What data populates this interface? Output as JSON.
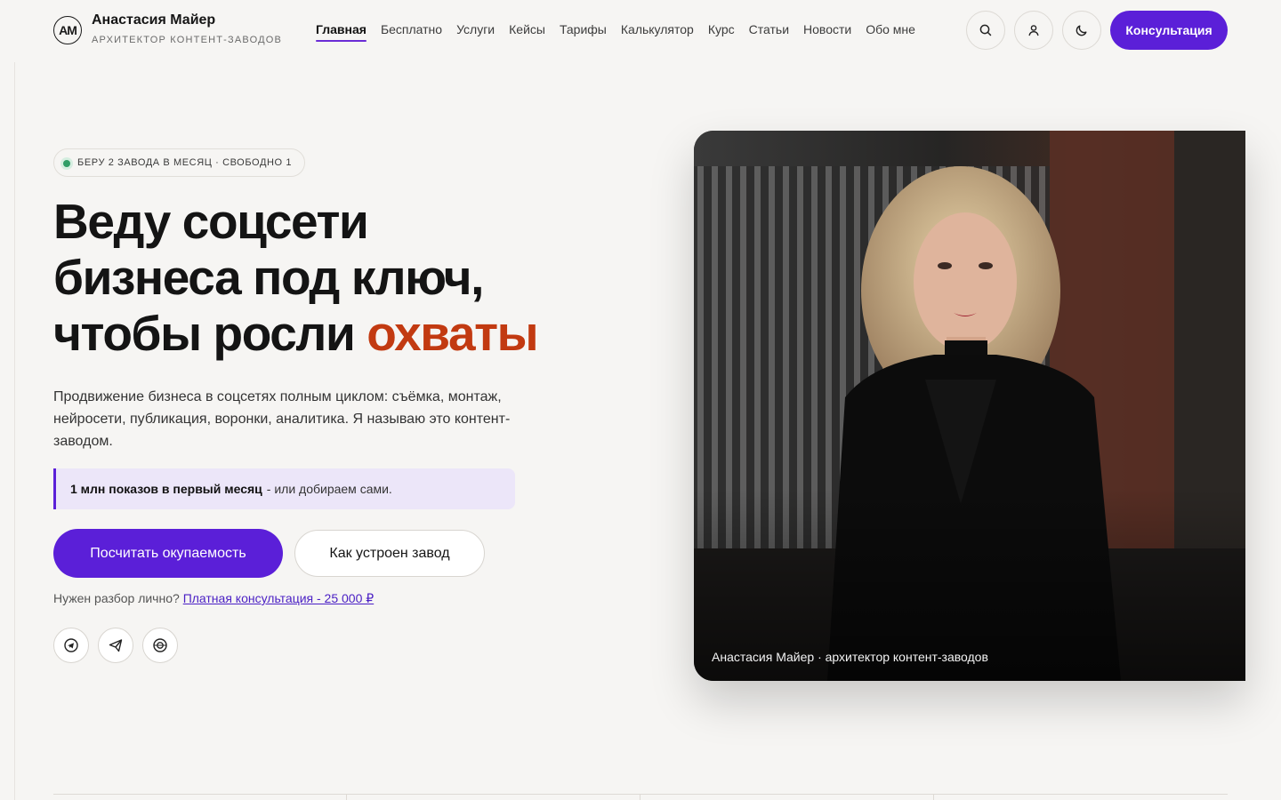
{
  "header": {
    "logo_text": "AM",
    "brand_name": "Анастасия Майер",
    "brand_sub": "АРХИТЕКТОР КОНТЕНТ-ЗАВОДОВ",
    "nav": [
      {
        "label": "Главная",
        "active": true
      },
      {
        "label": "Бесплатно"
      },
      {
        "label": "Услуги"
      },
      {
        "label": "Кейсы"
      },
      {
        "label": "Тарифы"
      },
      {
        "label": "Калькулятор"
      },
      {
        "label": "Курс"
      },
      {
        "label": "Статьи"
      },
      {
        "label": "Новости"
      },
      {
        "label": "Обо мне"
      }
    ],
    "icons": [
      "search-icon",
      "user-icon",
      "moon-icon"
    ],
    "cta_label": "Консультация"
  },
  "hero": {
    "badge": "БЕРУ 2 ЗАВОДА В МЕСЯЦ · СВОБОДНО 1",
    "headline_line1": "Веду соцсети",
    "headline_line2": "бизнеса под ключ,",
    "headline_line3_plain": "чтобы росли ",
    "headline_line3_accent": "охваты",
    "lead": "Продвижение бизнеса в соцсетях полным циклом: съёмка, монтаж, нейросети, публикация, воронки, аналитика. Я называю это контент-заводом.",
    "callout_strong": "1 млн показов в первый месяц",
    "callout_rest": "- или добираем сами.",
    "primary_button": "Посчитать окупаемость",
    "secondary_button": "Как устроен завод",
    "consult_prefix": "Нужен разбор лично?",
    "consult_link": "Платная консультация - 25 000 ₽",
    "socials": [
      "telegram-icon",
      "send-icon",
      "vk-icon"
    ]
  },
  "photo": {
    "caption": "Анастасия Майер · архитектор контент-заводов"
  },
  "colors": {
    "accent": "#5b1fd8",
    "highlight": "#c23a11",
    "background": "#f6f5f3"
  }
}
